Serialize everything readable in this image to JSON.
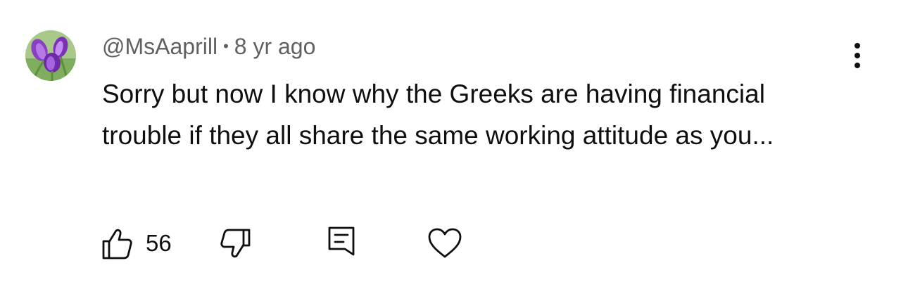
{
  "comment": {
    "author": "@MsAaprill",
    "separator": "•",
    "timestamp": "8 yr ago",
    "text": "Sorry but now I know why the Greeks are having financial trouble if they all share the same working attitude as you...",
    "like_count": "56"
  },
  "icons": {
    "avatar": "avatar-purple-crocus-flowers",
    "more": "more-vertical-icon",
    "like": "thumbs-up-icon",
    "dislike": "thumbs-down-icon",
    "reply": "reply-comment-icon",
    "heart": "heart-icon"
  },
  "colors": {
    "text": "#0f0f0f",
    "secondary_text": "#606060",
    "background": "#ffffff"
  }
}
